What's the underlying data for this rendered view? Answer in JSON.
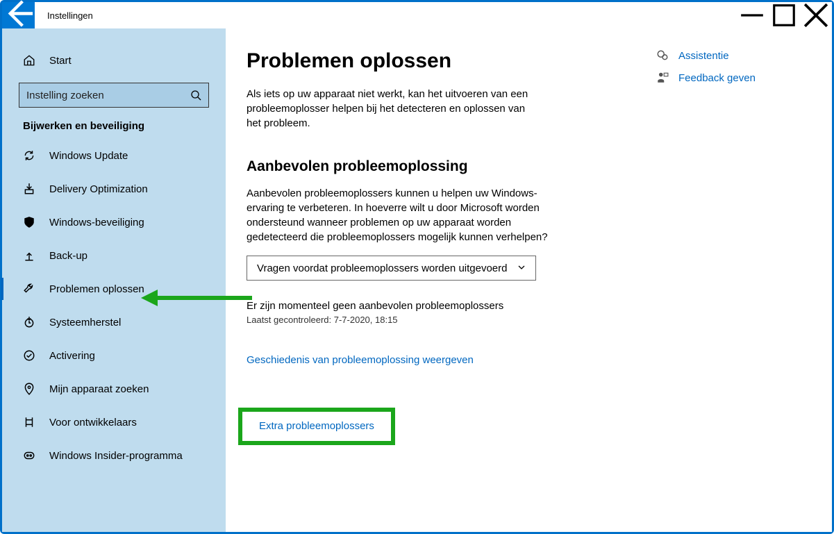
{
  "app": {
    "title": "Instellingen"
  },
  "sidebar": {
    "home": "Start",
    "search_placeholder": "Instelling zoeken",
    "section": "Bijwerken en beveiliging",
    "items": [
      {
        "label": "Windows Update"
      },
      {
        "label": "Delivery Optimization"
      },
      {
        "label": "Windows-beveiliging"
      },
      {
        "label": "Back-up"
      },
      {
        "label": "Problemen oplossen"
      },
      {
        "label": "Systeemherstel"
      },
      {
        "label": "Activering"
      },
      {
        "label": "Mijn apparaat zoeken"
      },
      {
        "label": "Voor ontwikkelaars"
      },
      {
        "label": "Windows Insider-programma"
      }
    ]
  },
  "main": {
    "title": "Problemen oplossen",
    "intro": "Als iets op uw apparaat niet werkt, kan het uitvoeren van een probleemoplosser helpen bij het detecteren en oplossen van het probleem.",
    "section_title": "Aanbevolen probleemoplossing",
    "section_desc": "Aanbevolen probleemoplossers kunnen u helpen uw Windows-ervaring te verbeteren. In hoeverre wilt u door Microsoft worden ondersteund wanneer problemen op uw apparaat worden gedetecteerd die probleemoplossers mogelijk kunnen verhelpen?",
    "dropdown_value": "Vragen voordat probleemoplossers worden uitgevoerd",
    "no_troubleshooters": "Er zijn momenteel geen aanbevolen probleemoplossers",
    "last_checked": "Laatst gecontroleerd: 7-7-2020, 18:15",
    "history_link": "Geschiedenis van probleemoplossing weergeven",
    "extra_link": "Extra probleemoplossers"
  },
  "aside": {
    "help": "Assistentie",
    "feedback": "Feedback geven"
  }
}
